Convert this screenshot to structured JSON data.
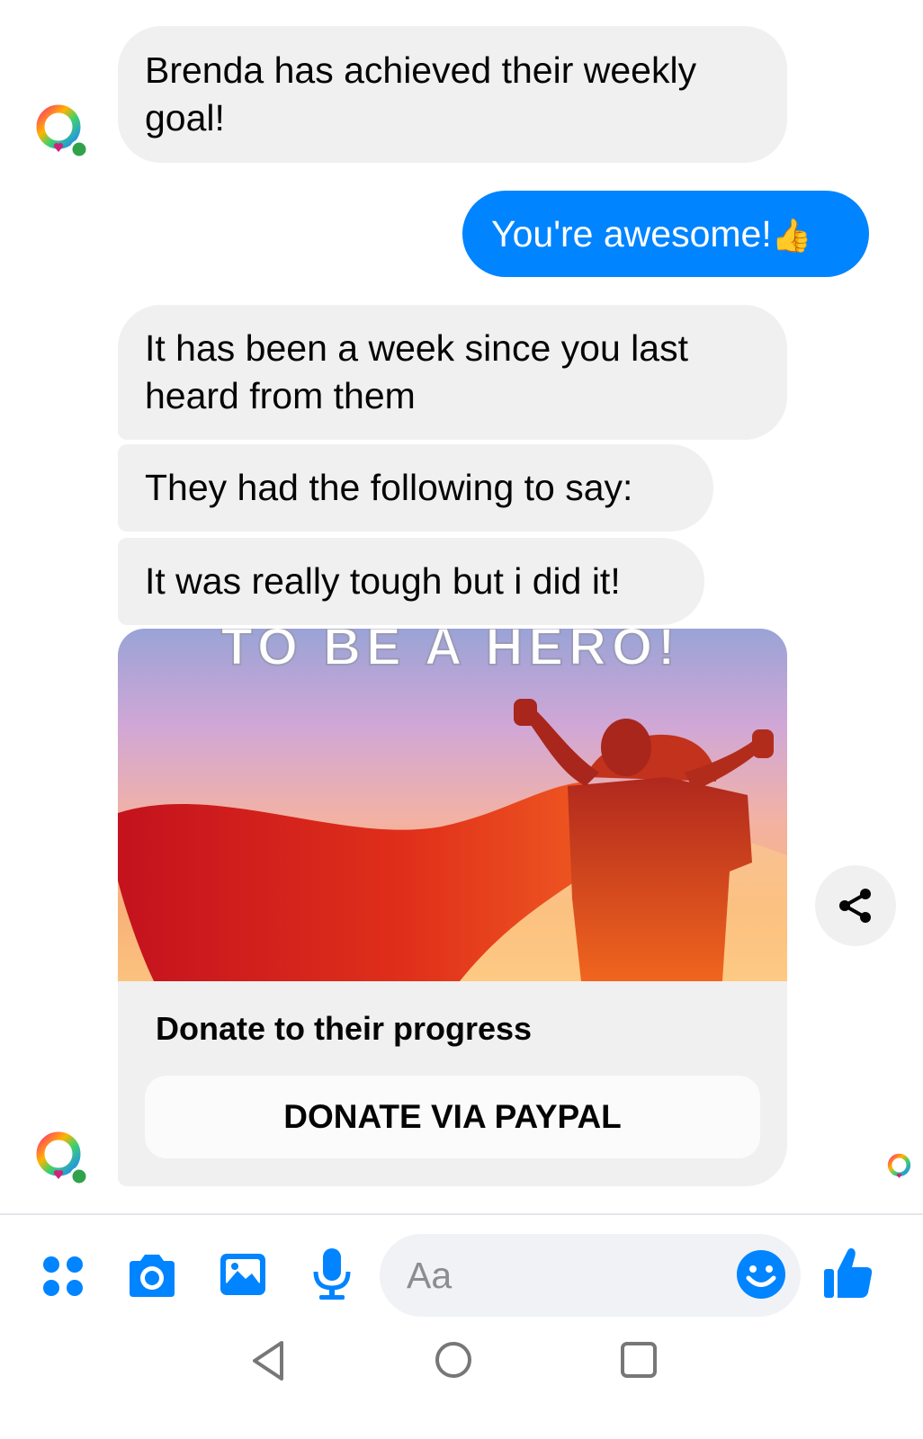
{
  "messages": {
    "m1": "Brenda has achieved their weekly goal!",
    "m2": "You're awesome!",
    "m2_emoji": "👍",
    "m3": "It has been a week since you last heard from them",
    "m4": "They had the following to say:",
    "m5": "It was really tough but i did it!"
  },
  "card": {
    "image_text": "TO BE A HERO!",
    "title": "Donate to their progress",
    "button": "DONATE VIA PAYPAL"
  },
  "composer": {
    "placeholder": "Aa"
  },
  "colors": {
    "accent": "#0084ff",
    "incoming_bubble": "#f0f0f0"
  },
  "icons": {
    "toolbar": [
      "apps-icon",
      "camera-icon",
      "gallery-icon",
      "microphone-icon",
      "emoji-icon",
      "thumbs-up-icon"
    ],
    "nav": [
      "back-icon",
      "home-icon",
      "recents-icon"
    ],
    "other": [
      "bot-avatar-icon",
      "share-icon",
      "read-receipt-avatar"
    ]
  }
}
